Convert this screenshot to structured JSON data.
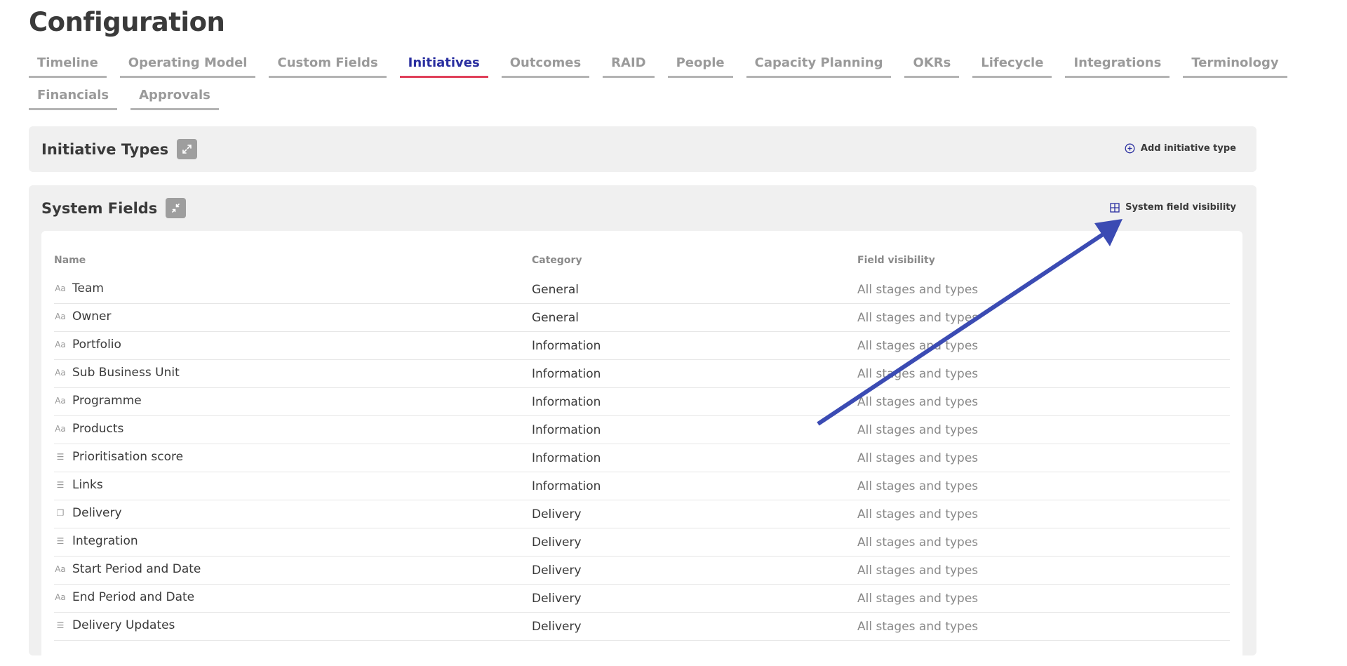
{
  "page": {
    "title": "Configuration"
  },
  "tabs_row1": [
    {
      "label": "Timeline",
      "active": false
    },
    {
      "label": "Operating Model",
      "active": false
    },
    {
      "label": "Custom Fields",
      "active": false
    },
    {
      "label": "Initiatives",
      "active": true
    },
    {
      "label": "Outcomes",
      "active": false
    },
    {
      "label": "RAID",
      "active": false
    },
    {
      "label": "People",
      "active": false
    },
    {
      "label": "Capacity Planning",
      "active": false
    },
    {
      "label": "OKRs",
      "active": false
    },
    {
      "label": "Lifecycle",
      "active": false
    },
    {
      "label": "Integrations",
      "active": false
    },
    {
      "label": "Terminology",
      "active": false
    }
  ],
  "tabs_row2": [
    {
      "label": "Financials",
      "active": false
    },
    {
      "label": "Approvals",
      "active": false
    }
  ],
  "initiative_types": {
    "title": "Initiative Types",
    "action_label": "Add initiative type",
    "action_icon": "plus-circle-icon",
    "toggle_icon": "expand-icon"
  },
  "system_fields": {
    "title": "System Fields",
    "action_label": "System field visibility",
    "action_icon": "grid-icon",
    "toggle_icon": "collapse-icon",
    "columns": {
      "name": "Name",
      "category": "Category",
      "visibility": "Field visibility"
    },
    "rows": [
      {
        "icon": "text-type-icon",
        "name": "Team",
        "category": "General",
        "visibility": "All stages and types"
      },
      {
        "icon": "text-type-icon",
        "name": "Owner",
        "category": "General",
        "visibility": "All stages and types"
      },
      {
        "icon": "text-type-icon",
        "name": "Portfolio",
        "category": "Information",
        "visibility": "All stages and types"
      },
      {
        "icon": "text-type-icon",
        "name": "Sub Business Unit",
        "category": "Information",
        "visibility": "All stages and types"
      },
      {
        "icon": "text-type-icon",
        "name": "Programme",
        "category": "Information",
        "visibility": "All stages and types"
      },
      {
        "icon": "text-type-icon",
        "name": "Products",
        "category": "Information",
        "visibility": "All stages and types"
      },
      {
        "icon": "list-type-icon",
        "name": "Prioritisation score",
        "category": "Information",
        "visibility": "All stages and types"
      },
      {
        "icon": "list-type-icon",
        "name": "Links",
        "category": "Information",
        "visibility": "All stages and types"
      },
      {
        "icon": "window-type-icon",
        "name": "Delivery",
        "category": "Delivery",
        "visibility": "All stages and types"
      },
      {
        "icon": "list-type-icon",
        "name": "Integration",
        "category": "Delivery",
        "visibility": "All stages and types"
      },
      {
        "icon": "text-type-icon",
        "name": "Start Period and Date",
        "category": "Delivery",
        "visibility": "All stages and types"
      },
      {
        "icon": "text-type-icon",
        "name": "End Period and Date",
        "category": "Delivery",
        "visibility": "All stages and types"
      },
      {
        "icon": "list-type-icon",
        "name": "Delivery Updates",
        "category": "Delivery",
        "visibility": "All stages and types"
      }
    ]
  },
  "colors": {
    "accent": "#2a2fa0",
    "active_underline": "#e0405a",
    "annotation_arrow": "#3b4bb3"
  }
}
